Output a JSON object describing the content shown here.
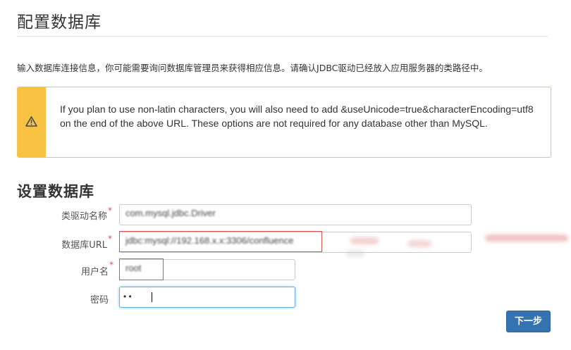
{
  "page": {
    "title": "配置数据库",
    "intro": "输入数据库连接信息，你可能需要询问数据库管理员来获得相应信息。请确认JDBC驱动已经放入应用服务器的类路径中。"
  },
  "alert": {
    "icon": "warning-icon",
    "accent_color": "#f7c242",
    "message": "If you plan to use non-latin characters, you will also need to add &useUnicode=true&characterEncoding=utf8 on the end of the above URL. These options are not required for any database other than MySQL."
  },
  "form": {
    "section_title": "设置数据库",
    "required_mark": "*",
    "driver": {
      "label": "类驱动名称",
      "value": "com.mysql.jdbc.Driver"
    },
    "url": {
      "label": "数据库URL",
      "value": "jdbc:mysql://192.168.x.x:3306/confluence"
    },
    "username": {
      "label": "用户名",
      "value": "root"
    },
    "password": {
      "label": "密码",
      "masked": "•      •"
    },
    "next_label": "下一步",
    "button_color": "#3572b0"
  }
}
